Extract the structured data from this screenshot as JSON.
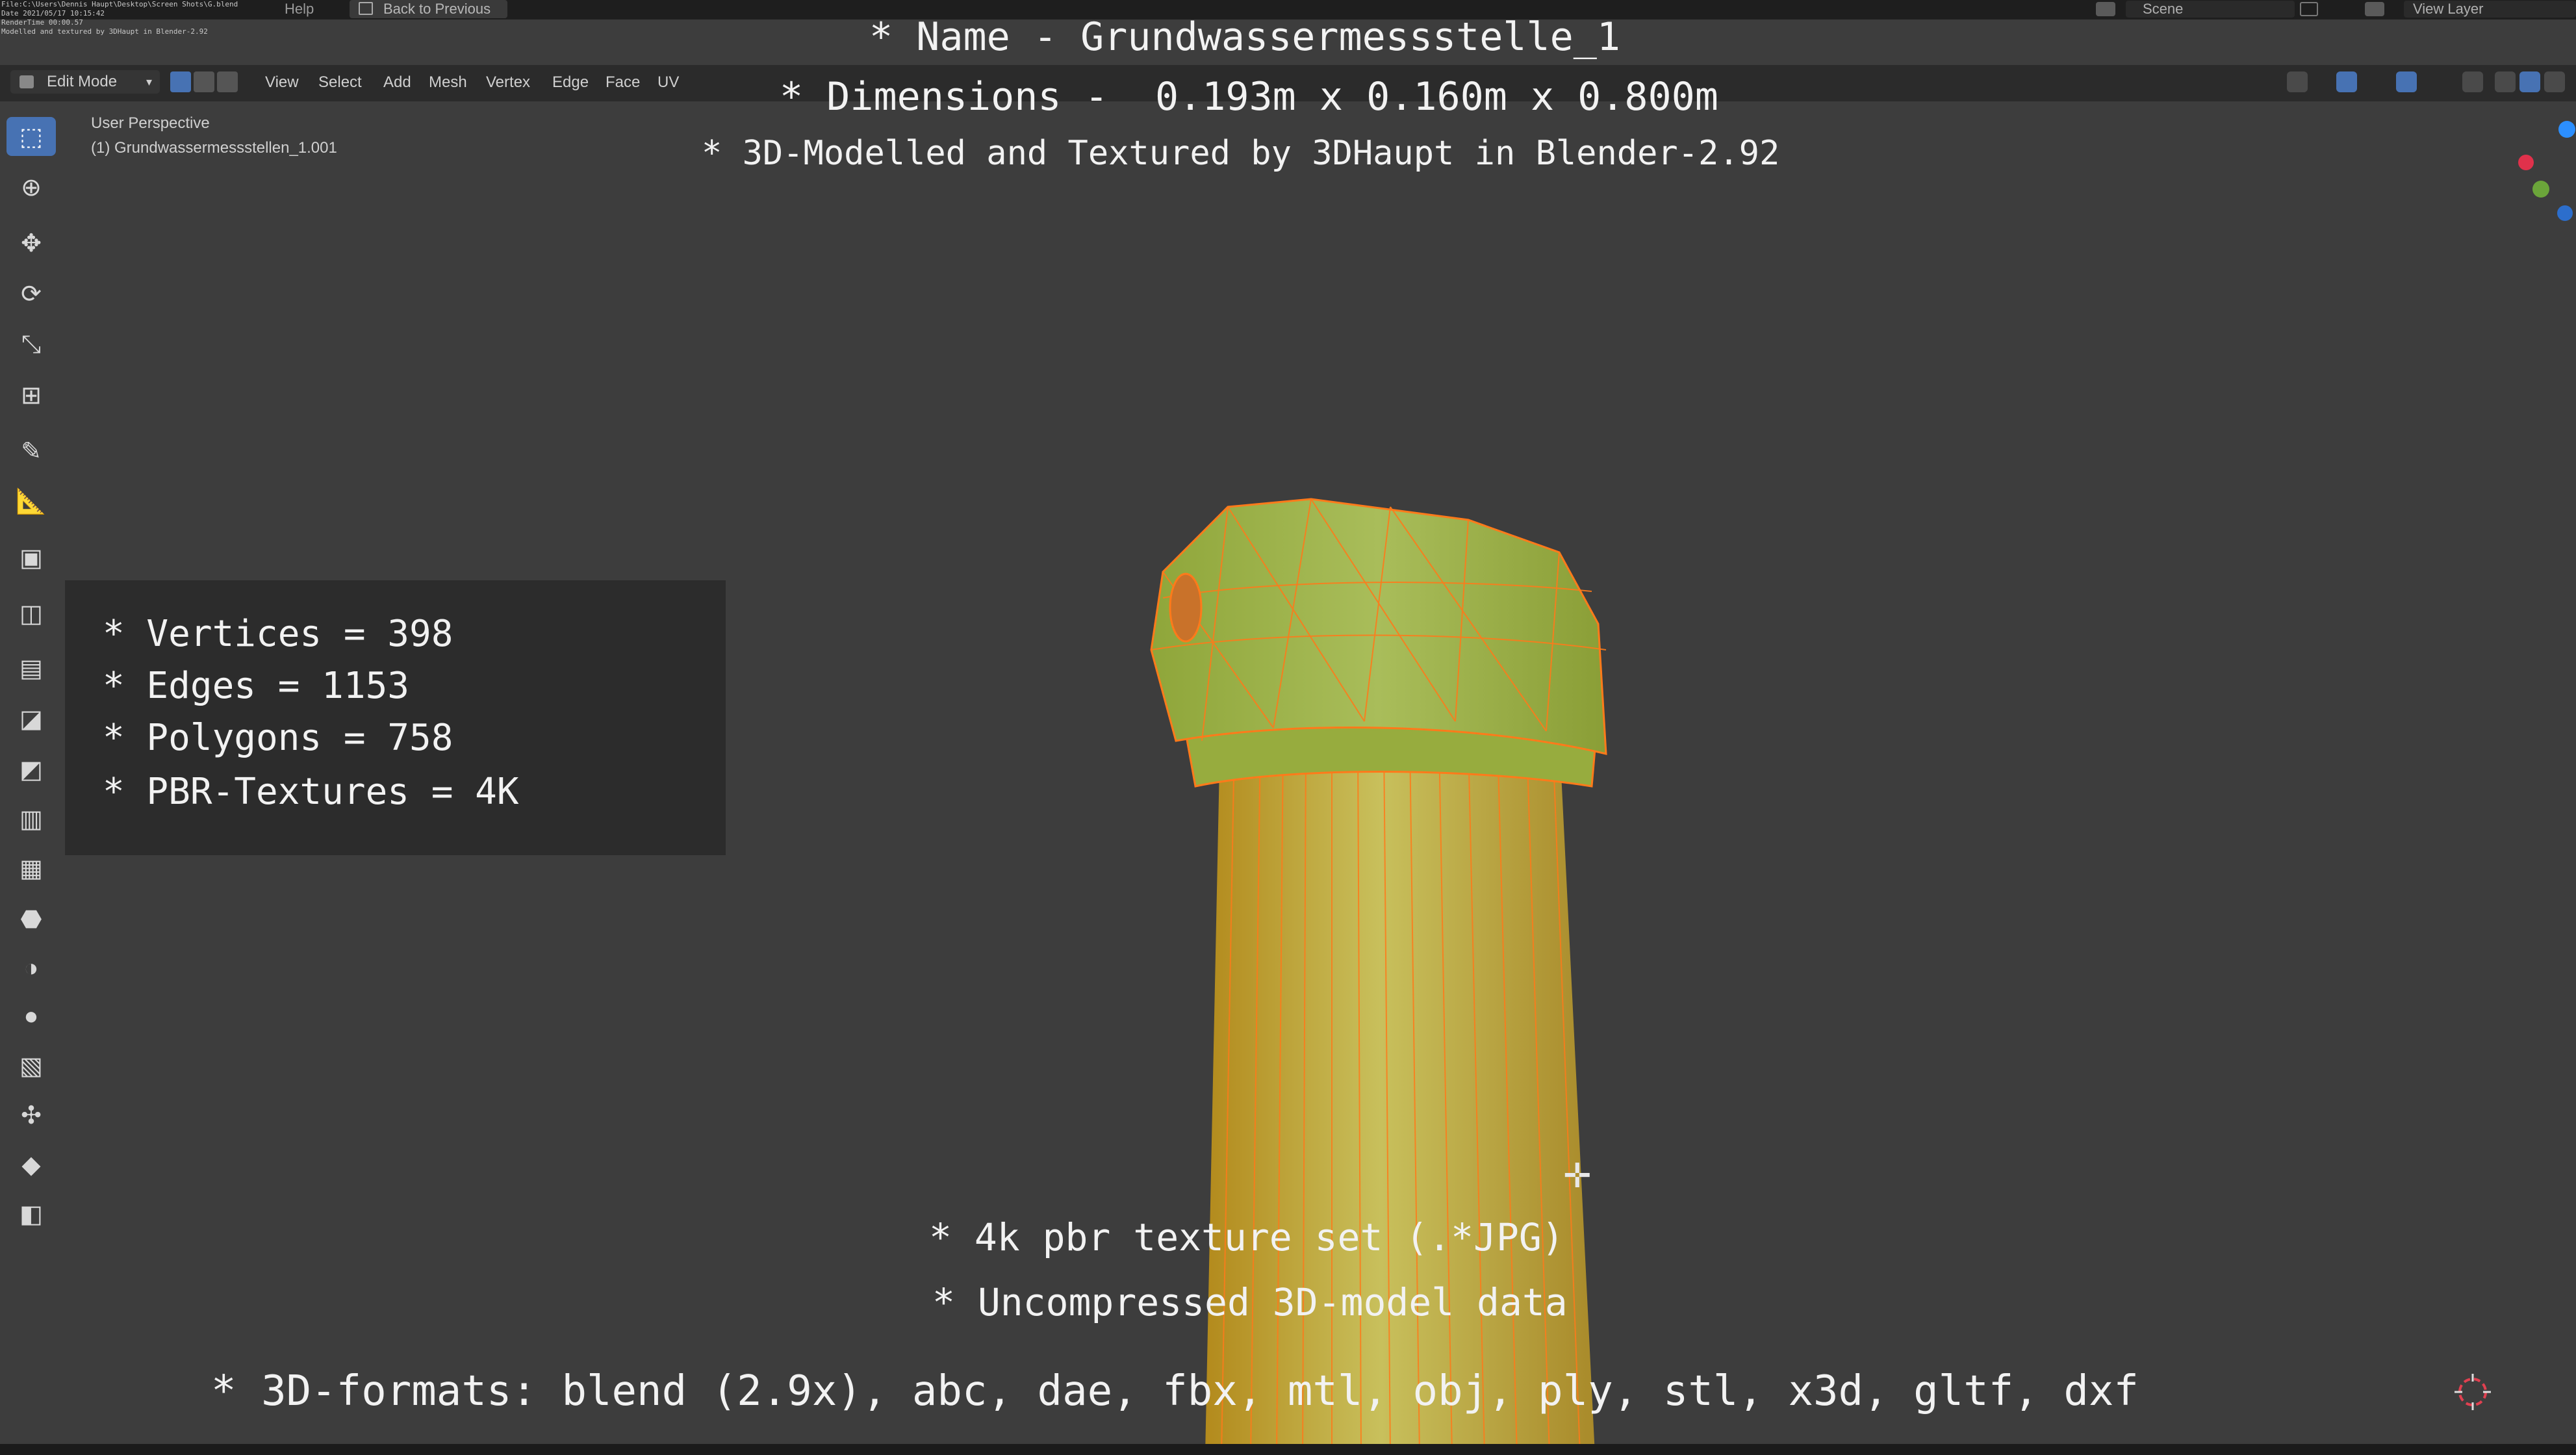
{
  "top_bar": {
    "info_lines": [
      "File:C:\\Users\\Dennis Haupt\\Desktop\\Screen Shots\\G.blend",
      "Date 2021/05/17 10:15:42",
      "RenderTime 00:00.57",
      "Modelled and textured by 3DHaupt in Blender-2.92"
    ],
    "help_label": "Help",
    "back_label": "Back to Previous",
    "scene_label": "Scene",
    "view_layer_label": "View Layer"
  },
  "header": {
    "mode_label": "Edit Mode",
    "menu": [
      "View",
      "Select",
      "Add",
      "Mesh",
      "Vertex",
      "Edge",
      "Face",
      "UV"
    ]
  },
  "viewport": {
    "perspective_label": "User Perspective",
    "object_label": "(1) Grundwassermessstellen_1.001"
  },
  "overlay": {
    "name_line": "* Name - Grundwassermessstelle_1",
    "dimensions_line": "* Dimensions -  0.193m x 0.160m x 0.800m",
    "credit_line": "* 3D-Modelled and Textured by 3DHaupt in Blender-2.92",
    "stats": [
      "* Vertices = 398",
      "* Edges = 1153",
      "* Polygons = 758",
      "* PBR-Textures = 4K"
    ],
    "texture_line": "* 4k pbr texture set (.*JPG)",
    "uncompressed_line": "* Uncompressed 3D-model data",
    "formats_line": "* 3D-formats: blend (2.9x), abc, dae, fbx, mtl, obj, ply, stl, x3d, gltf, dxf"
  },
  "gizmo": {
    "x_color": "#e0314b",
    "y_color": "#6ba53a",
    "z_color": "#2c8fff"
  },
  "accent_color": "#4772b3",
  "mesh_color": "#9fb83e",
  "wire_color": "#ff7a1a",
  "tools": [
    "select-icon",
    "cursor-icon",
    "move-icon",
    "rotate-icon",
    "scale-icon",
    "transform-icon",
    "annotate-icon",
    "measure-icon",
    "add-cube-icon",
    "extrude-icon",
    "inset-icon",
    "bevel-icon",
    "loop-cut-icon",
    "knife-icon",
    "poly-build-icon",
    "spin-icon",
    "smooth-icon",
    "edge-slide-icon",
    "shrink-icon",
    "shear-icon",
    "rip-icon"
  ]
}
